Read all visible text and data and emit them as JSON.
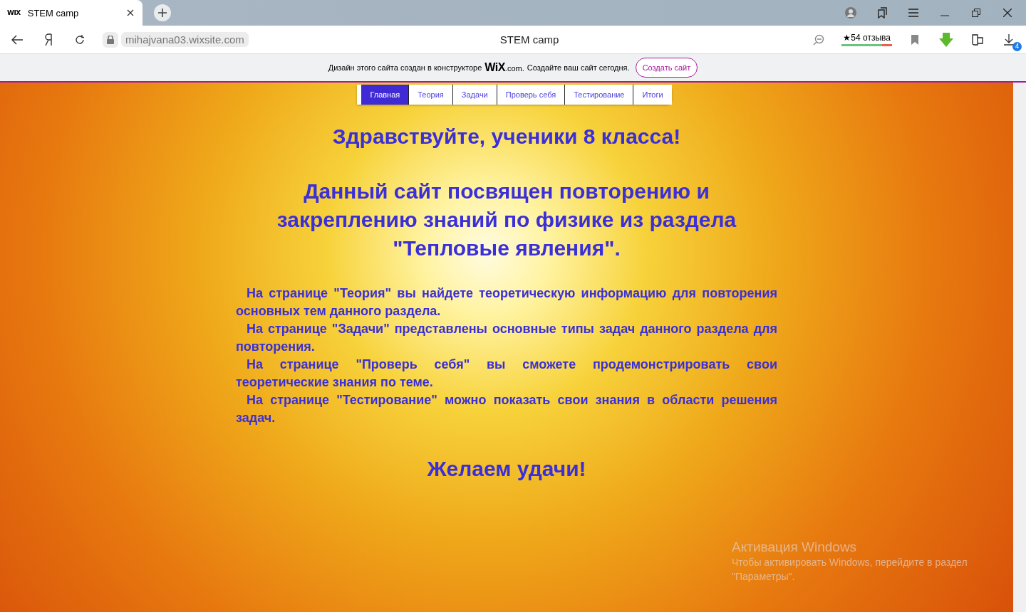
{
  "browser": {
    "tab": {
      "favicon": "WIX",
      "title": "STEM camp"
    },
    "address": "mihajvana03.wixsite.com",
    "page_title": "STEM camp",
    "reviews": "★54 отзыва",
    "downloads_badge": "4"
  },
  "wix_banner": {
    "text_before": "Дизайн этого сайта создан в конструкторе",
    "logo": "WiX",
    "logo_suffix": ".com.",
    "text_after": "Создайте ваш сайт сегодня.",
    "button": "Создать сайт"
  },
  "nav": [
    {
      "label": "Главная",
      "selected": true
    },
    {
      "label": "Теория",
      "selected": false
    },
    {
      "label": "Задачи",
      "selected": false
    },
    {
      "label": "Проверь себя",
      "selected": false
    },
    {
      "label": "Тестирование",
      "selected": false
    },
    {
      "label": "Итоги",
      "selected": false
    }
  ],
  "greeting": "Здравствуйте, ученики 8 класса!",
  "intro": "Данный сайт посвящен повторению и закреплению знаний по физике из раздела \"Тепловые явления\".",
  "paragraphs": [
    "На странице \"Теория\" вы найдете теоретическую информацию для повторения основных тем данного раздела.",
    "На странице \"Задачи\" представлены основные типы задач данного раздела для повторения.",
    "На странице \"Проверь себя\" вы сможете продемонстрировать свои теоретические знания по теме.",
    "На странице \"Тестирование\" можно показать свои знания в области решения задач."
  ],
  "closing": "Желаем удачи!",
  "windows_activation": {
    "title": "Активация Windows",
    "text": "Чтобы активировать Windows, перейдите в раздел \"Параметры\"."
  }
}
